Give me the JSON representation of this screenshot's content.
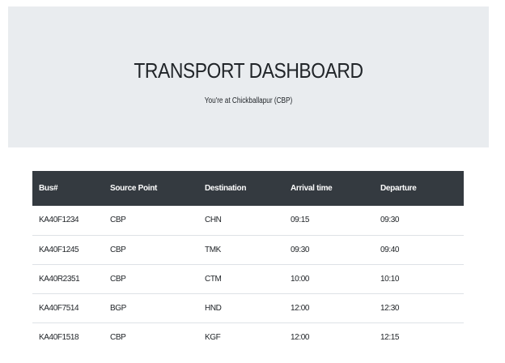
{
  "header": {
    "title": "TRANSPORT DASHBOARD",
    "subtitle": "You're at Chickballapur (CBP)"
  },
  "table": {
    "columns": [
      "Bus#",
      "Source Point",
      "Destination",
      "Arrival time",
      "Departure"
    ],
    "rows": [
      [
        "KA40F1234",
        "CBP",
        "CHN",
        "09:15",
        "09:30"
      ],
      [
        "KA40F1245",
        "CBP",
        "TMK",
        "09:30",
        "09:40"
      ],
      [
        "KA40R2351",
        "CBP",
        "CTM",
        "10:00",
        "10:10"
      ],
      [
        "KA40F7514",
        "BGP",
        "HND",
        "12:00",
        "12:30"
      ],
      [
        "KA40F1518",
        "CBP",
        "KGF",
        "12:00",
        "12:15"
      ]
    ]
  },
  "colors": {
    "hero_background": "#e9ecef",
    "table_header_background": "#343a40",
    "row_divider": "#dee2e6"
  }
}
